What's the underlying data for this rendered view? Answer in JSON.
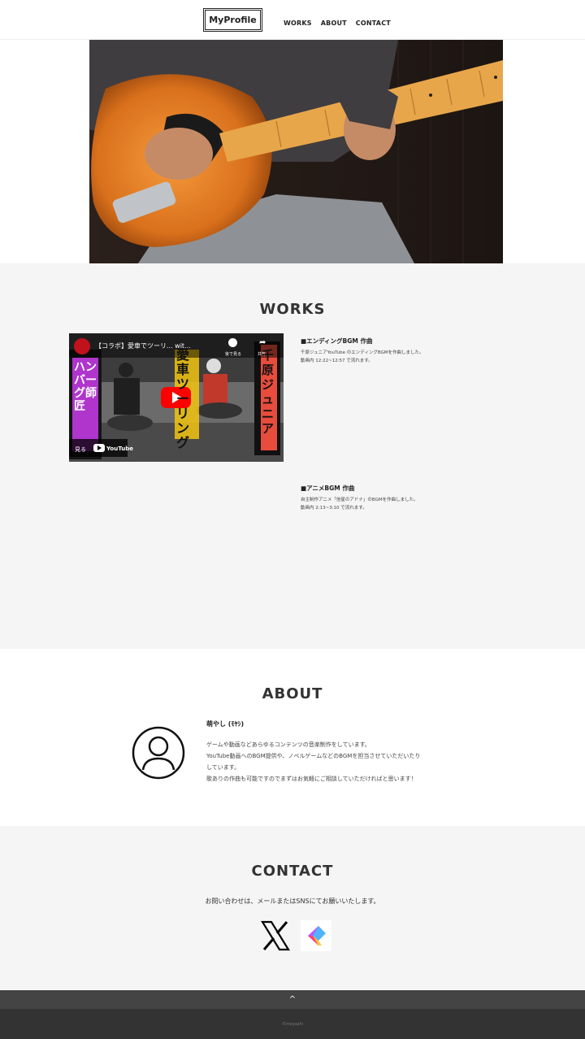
{
  "header": {
    "logo": "MyProfile",
    "nav": [
      {
        "label": "WORKS"
      },
      {
        "label": "ABOUT"
      },
      {
        "label": "CONTACT"
      }
    ]
  },
  "works": {
    "title": "WORKS",
    "video": {
      "title": "【コラボ】愛車でツーリ... wit...",
      "watch_later": "後で見る",
      "share": "共有",
      "watch_on": "見る",
      "platform": "YouTube",
      "thumb_text_right": "千原ジュニア",
      "thumb_text_center": "愛車ツーリング",
      "thumb_text_left": "ハンバーグ師匠"
    },
    "items": [
      {
        "title": "■エンディングBGM 作曲",
        "line1": "千原ジュニアYouTube のエンディングBGMを作曲しました。",
        "line2": "動画内 12:22~12:57 で流れます。"
      },
      {
        "title": "■アニメBGM 作曲",
        "line1": "自主制作アニメ「信星のアドナ」のBGMを作曲しました。",
        "line2": "動画内 2:13~3:10 で流れます。"
      }
    ]
  },
  "about": {
    "title": "ABOUT",
    "name": "萌やし (ﾓﾔｼ)",
    "line1": "ゲームや動画などあらゆるコンテンツの音楽制作をしています。",
    "line2": "YouTube動画へのBGM提供や、ノベルゲームなどのBGMを担当させていただいたり",
    "line3": "しています。",
    "line4": "歌ありの作曲も可能ですのでまずはお気軽にご相談していただければと思います！"
  },
  "contact": {
    "title": "CONTACT",
    "text": "お問い合わせは、メールまたはSNSにてお願いいたします。",
    "sns": [
      {
        "icon": "x-logo-icon"
      },
      {
        "icon": "skeb-logo-icon"
      }
    ]
  },
  "footer": {
    "totop": "^",
    "copyright": "©moyashi"
  },
  "colors": {
    "section_bg": "#f5f5f5",
    "footer_bg": "#333333",
    "youtube_red": "#ff0000"
  }
}
